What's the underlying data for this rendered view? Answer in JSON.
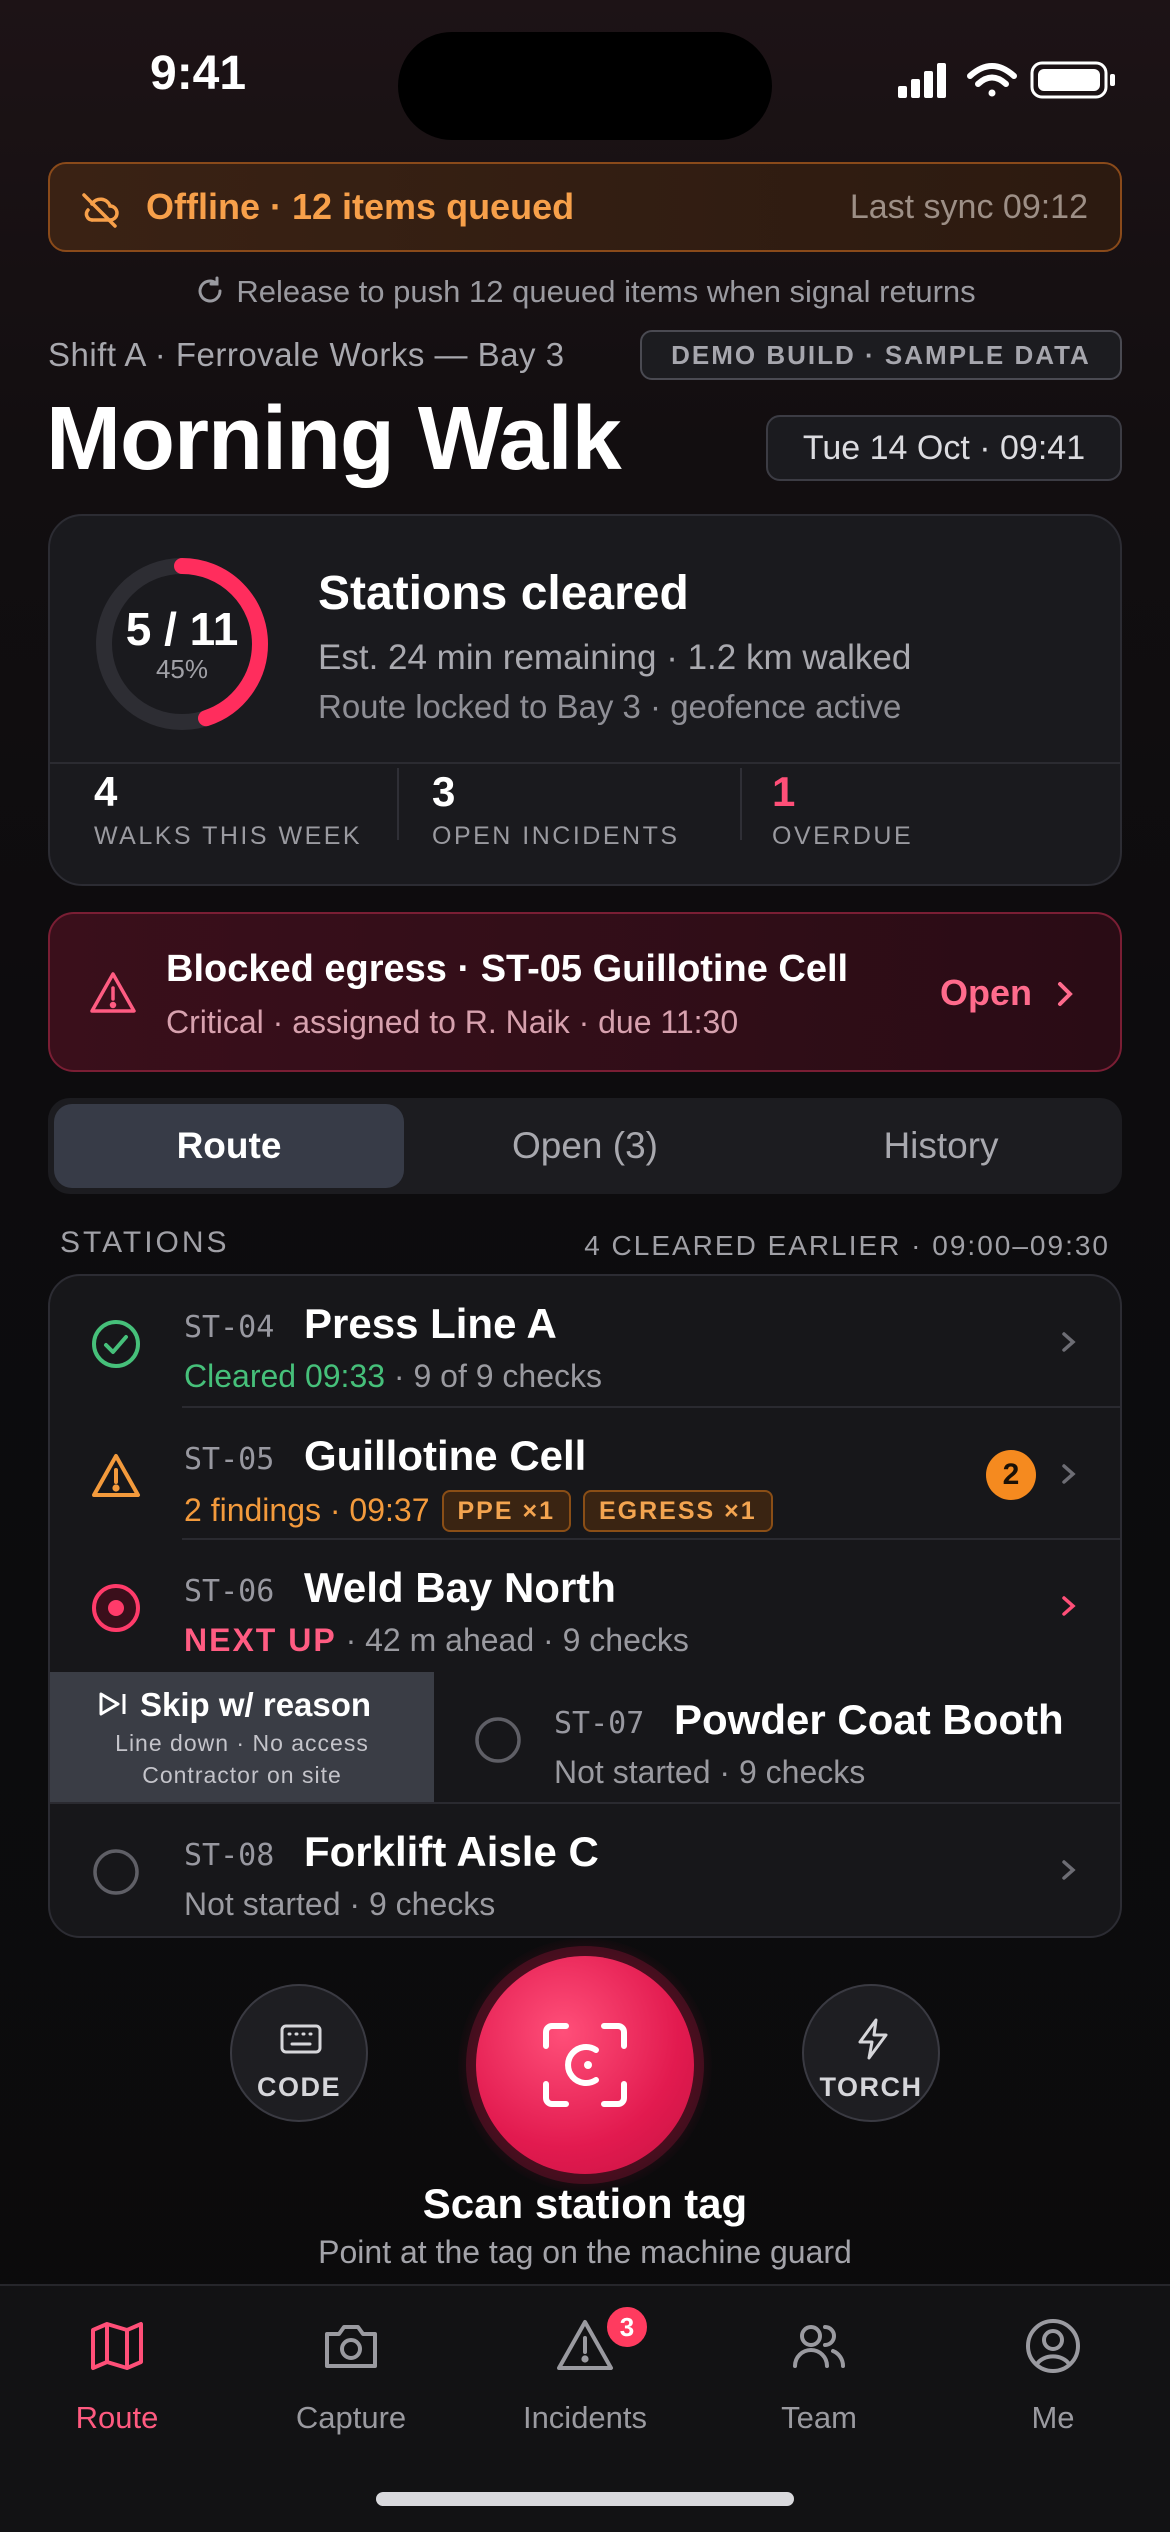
{
  "status_bar": {
    "time": "9:41"
  },
  "offline_banner": {
    "text": "Offline · 12 items queued",
    "last_sync": "Last sync 09:12",
    "accent": "#f7a04a"
  },
  "release_hint": "Release to push 12 queued items when signal returns",
  "header": {
    "shift": "Shift A · Ferrovale Works — Bay 3",
    "demo_badge": "DEMO BUILD · SAMPLE DATA",
    "title": "Morning Walk",
    "date": "Tue 14 Oct · 09:41"
  },
  "progress": {
    "value": "5 / 11",
    "percent": "45%",
    "fraction": 0.45,
    "title": "Stations cleared",
    "line1": "Est. 24 min remaining · 1.2 km walked",
    "line2": "Route locked to Bay 3 · geofence active",
    "stats": [
      {
        "num": "4",
        "label": "WALKS THIS WEEK"
      },
      {
        "num": "3",
        "label": "OPEN INCIDENTS"
      },
      {
        "num": "1",
        "label": "OVERDUE"
      }
    ]
  },
  "alert": {
    "title": "Blocked egress · ST-05 Guillotine Cell",
    "subtitle": "Critical · assigned to R. Naik · due 11:30",
    "action": "Open"
  },
  "tabs": [
    {
      "label": "Route"
    },
    {
      "label": "Open (3)"
    },
    {
      "label": "History"
    }
  ],
  "stations": {
    "heading": "STATIONS",
    "summary": "4 CLEARED EARLIER · 09:00–09:30",
    "rows": [
      {
        "code": "ST-04",
        "name": "Press Line A",
        "status": "Cleared 09:33",
        "meta": " · 9 of 9 checks"
      },
      {
        "code": "ST-05",
        "name": "Guillotine Cell",
        "status": "2 findings · 09:37",
        "tags": [
          "PPE ×1",
          "EGRESS ×1"
        ],
        "badge": "2"
      },
      {
        "code": "ST-06",
        "name": "Weld Bay North",
        "status": "NEXT UP",
        "meta": " · 42 m ahead · 9 checks"
      },
      {
        "code": "ST-07",
        "name": "Powder Coat Booth",
        "meta": "Not started · 9 checks"
      },
      {
        "code": "ST-08",
        "name": "Forklift Aisle C",
        "meta": "Not started · 9 checks"
      }
    ],
    "skip_action": {
      "label": "Skip w/ reason",
      "reasons_line1": "Line down · No access",
      "reasons_line2": "Contractor on site"
    }
  },
  "scan": {
    "code_label": "CODE",
    "torch_label": "TORCH",
    "title": "Scan station tag",
    "subtitle": "Point at the tag on the machine guard"
  },
  "tabbar": [
    {
      "label": "Route",
      "icon": "map-icon"
    },
    {
      "label": "Capture",
      "icon": "camera-icon"
    },
    {
      "label": "Incidents",
      "icon": "warning-icon",
      "badge": "3"
    },
    {
      "label": "Team",
      "icon": "team-icon"
    },
    {
      "label": "Me",
      "icon": "profile-icon"
    }
  ],
  "colors": {
    "accent": "#ff3b6a",
    "cleared": "#46c07a",
    "warning": "#f39a3c"
  }
}
